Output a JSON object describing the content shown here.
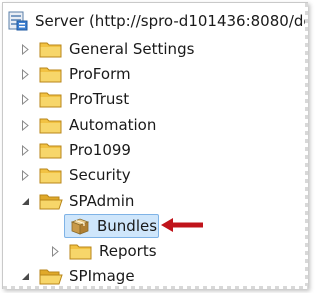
{
  "tree": {
    "root": {
      "label": "Server (http://spro-d101436:8080/de",
      "icon": "server-icon"
    },
    "items": [
      {
        "label": "General Settings",
        "icon": "folder-icon",
        "expanded": false
      },
      {
        "label": "ProForm",
        "icon": "folder-icon",
        "expanded": false
      },
      {
        "label": "ProTrust",
        "icon": "folder-icon",
        "expanded": false
      },
      {
        "label": "Automation",
        "icon": "folder-icon",
        "expanded": false
      },
      {
        "label": "Pro1099",
        "icon": "folder-icon",
        "expanded": false
      },
      {
        "label": "Security",
        "icon": "folder-icon",
        "expanded": false
      },
      {
        "label": "SPAdmin",
        "icon": "folder-open-icon",
        "expanded": true,
        "children": [
          {
            "label": "Bundles",
            "icon": "bundle-icon",
            "selected": true
          },
          {
            "label": "Reports",
            "icon": "folder-icon",
            "expanded": false
          }
        ]
      },
      {
        "label": "SPImage",
        "icon": "folder-open-icon",
        "expanded": true
      }
    ]
  },
  "colors": {
    "selection_bg": "#cfe6fb",
    "selection_border": "#7fb3e6",
    "folder": "#f2c243",
    "callout_arrow": "#c0141b"
  }
}
